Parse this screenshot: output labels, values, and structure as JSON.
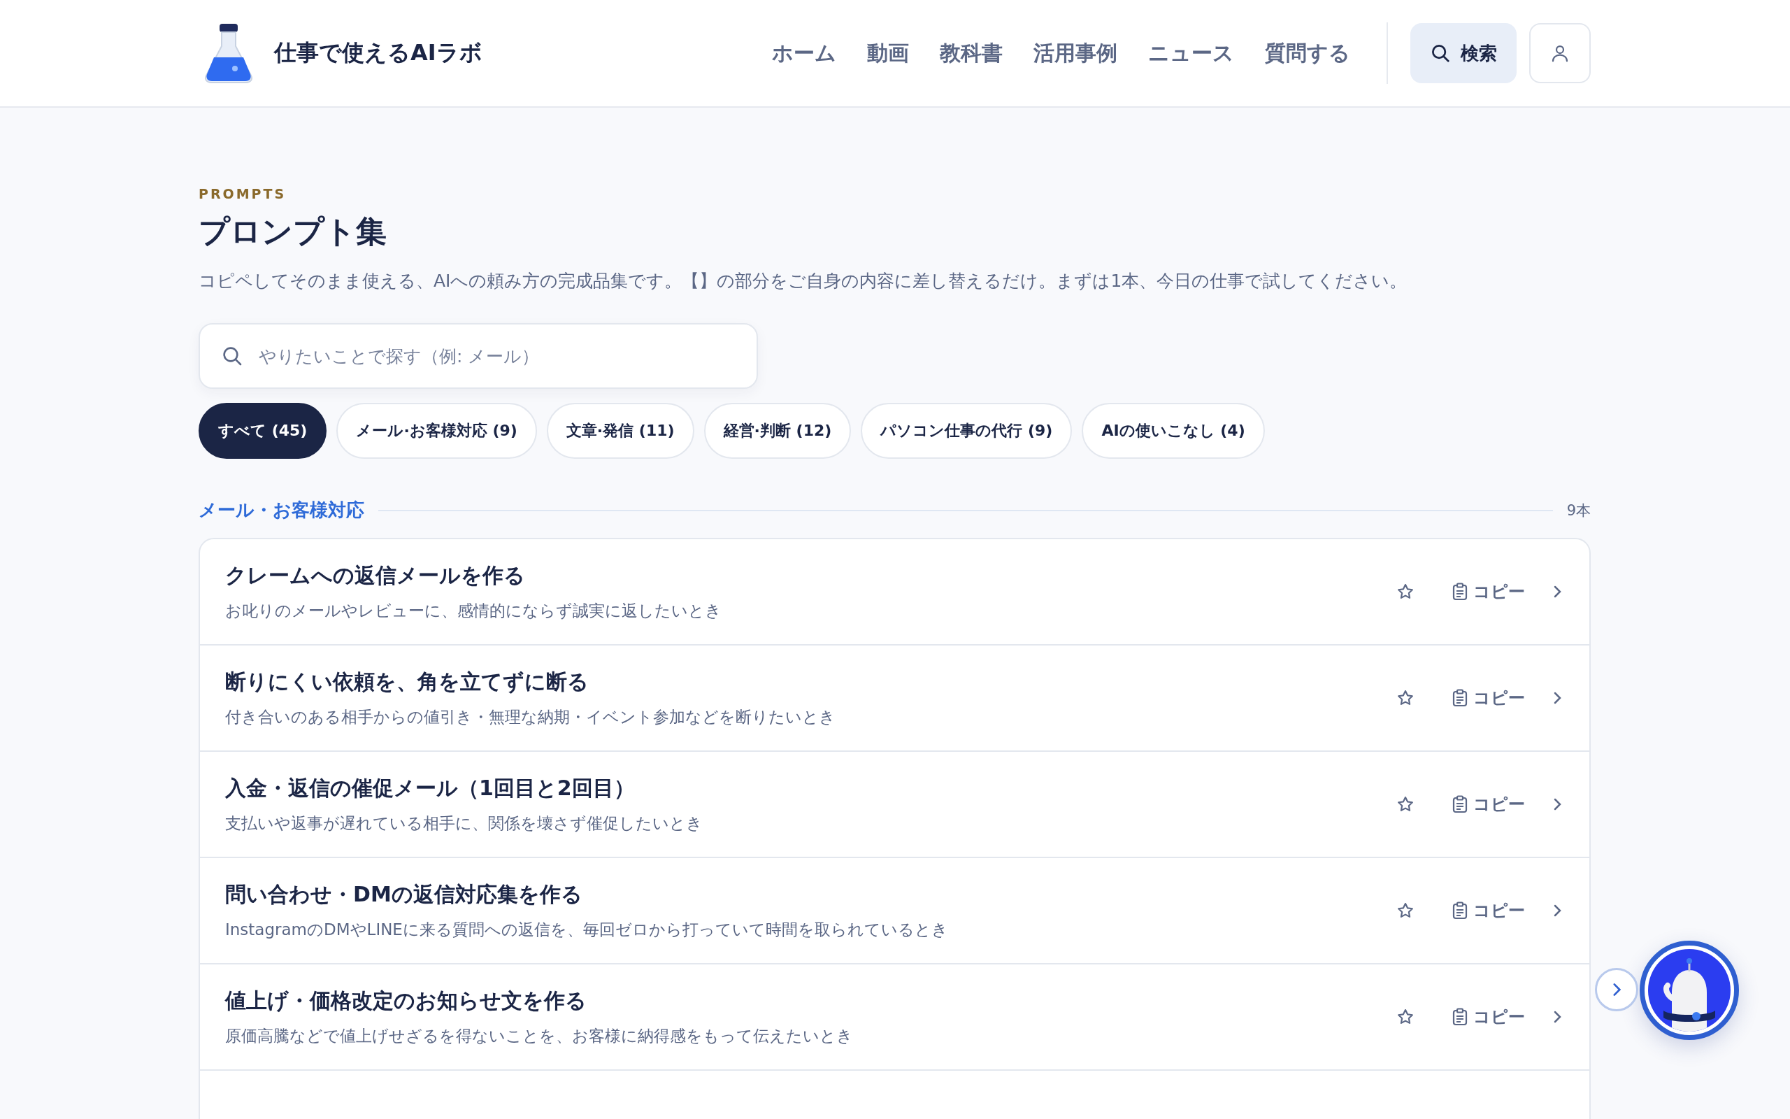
{
  "header": {
    "site_name": "仕事で使えるAIラボ",
    "nav": [
      {
        "label": "ホーム"
      },
      {
        "label": "動画"
      },
      {
        "label": "教科書"
      },
      {
        "label": "活用事例"
      },
      {
        "label": "ニュース"
      },
      {
        "label": "質問する"
      }
    ],
    "search_button": "検索"
  },
  "page": {
    "eyebrow": "PROMPTS",
    "title": "プロンプト集",
    "description": "コピペしてそのまま使える、AIへの頼み方の完成品集です。【】の部分をご自身の内容に差し替えるだけ。まずは1本、今日の仕事で試してください。"
  },
  "search": {
    "placeholder": "やりたいことで探す（例: メール）"
  },
  "filters": [
    {
      "label": "すべて (45)",
      "selected": true
    },
    {
      "label": "メール·お客様対応 (9)",
      "selected": false
    },
    {
      "label": "文章·発信 (11)",
      "selected": false
    },
    {
      "label": "経営·判断 (12)",
      "selected": false
    },
    {
      "label": "パソコン仕事の代行 (9)",
      "selected": false
    },
    {
      "label": "AIの使いこなし (4)",
      "selected": false
    }
  ],
  "section": {
    "title": "メール・お客様対応",
    "count": "9本"
  },
  "prompts": [
    {
      "title": "クレームへの返信メールを作る",
      "subtitle": "お叱りのメールやレビューに、感情的にならず誠実に返したいとき",
      "copy_label": "コピー"
    },
    {
      "title": "断りにくい依頼を、角を立てずに断る",
      "subtitle": "付き合いのある相手からの値引き・無理な納期・イベント参加などを断りたいとき",
      "copy_label": "コピー"
    },
    {
      "title": "入金・返信の催促メール（1回目と2回目）",
      "subtitle": "支払いや返事が遅れている相手に、関係を壊さず催促したいとき",
      "copy_label": "コピー"
    },
    {
      "title": "問い合わせ・DMの返信対応集を作る",
      "subtitle": "InstagramのDMやLINEに来る質問への返信を、毎回ゼロから打っていて時間を取られているとき",
      "copy_label": "コピー"
    },
    {
      "title": "値上げ・価格改定のお知らせ文を作る",
      "subtitle": "原価高騰などで値上げせざるを得ないことを、お客様に納得感をもって伝えたいとき",
      "copy_label": "コピー"
    }
  ]
}
